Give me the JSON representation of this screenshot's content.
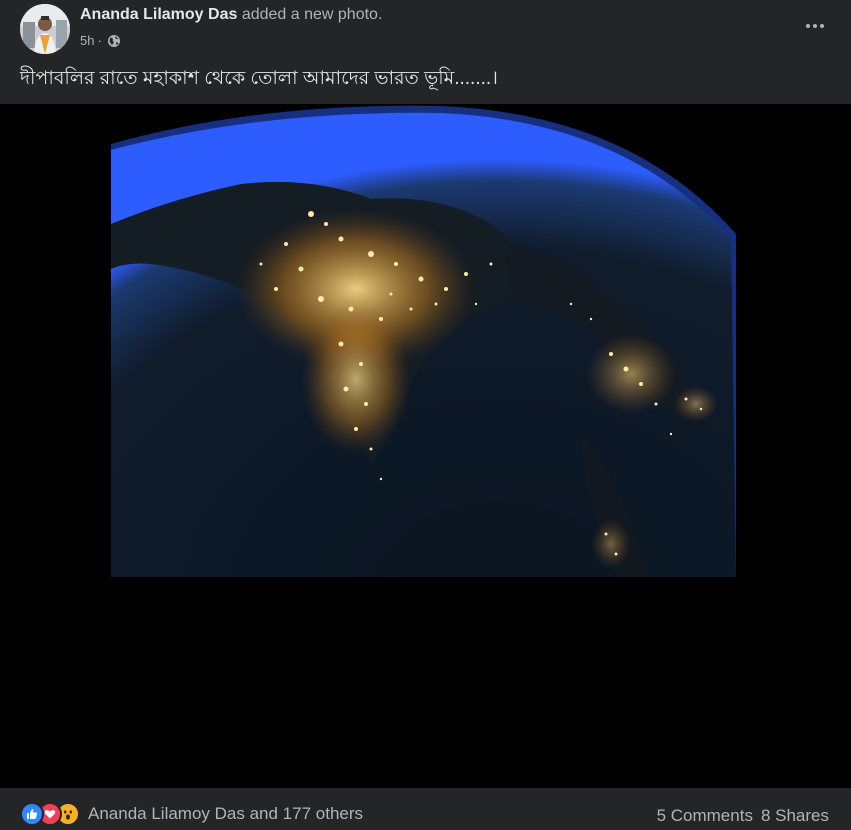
{
  "post": {
    "author": "Ananda Lilamoy Das",
    "action": "added a new photo.",
    "time": "5h",
    "separator": "·",
    "audience_icon": "globe-icon",
    "more_icon": "more-horizontal-icon",
    "caption": "দীপাবলির রাতে মহাকাশ থেকে তোলা আমাদের ভারত ভূমি.......।"
  },
  "photo": {
    "subject": "earth-at-night-india-icon"
  },
  "footer": {
    "reaction_icons": [
      "like-icon",
      "love-icon",
      "wow-icon"
    ],
    "reactions_text": "Ananda Lilamoy Das and 177 others",
    "comments": "5 Comments",
    "shares": "8 Shares"
  },
  "colors": {
    "card_bg": "#242526",
    "photo_bg": "#000000",
    "primary_text": "#e4e6eb",
    "secondary_text": "#b0b3b8",
    "like_blue": "#2e89ff",
    "love_red": "#f33e58",
    "wow_yellow": "#f7b125"
  }
}
